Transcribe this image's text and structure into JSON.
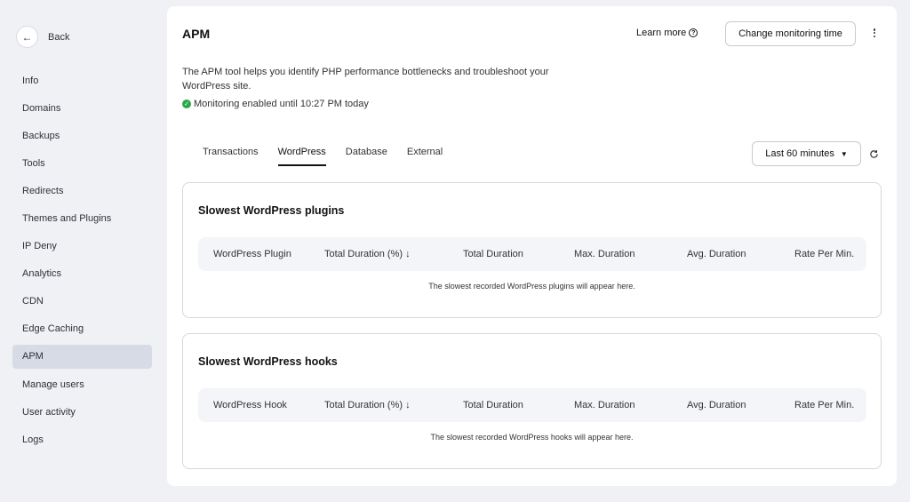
{
  "sidebar": {
    "back_label": "Back",
    "items": [
      {
        "label": "Info"
      },
      {
        "label": "Domains"
      },
      {
        "label": "Backups"
      },
      {
        "label": "Tools"
      },
      {
        "label": "Redirects"
      },
      {
        "label": "Themes and Plugins"
      },
      {
        "label": "IP Deny"
      },
      {
        "label": "Analytics"
      },
      {
        "label": "CDN"
      },
      {
        "label": "Edge Caching"
      },
      {
        "label": "APM",
        "active": true
      },
      {
        "label": "Manage users"
      },
      {
        "label": "User activity"
      },
      {
        "label": "Logs"
      }
    ]
  },
  "header": {
    "title": "APM",
    "learn_more": "Learn more",
    "change_monitoring": "Change monitoring time",
    "description": "The APM tool helps you identify PHP performance bottlenecks and troubleshoot your WordPress site.",
    "status": "Monitoring enabled until 10:27 PM today",
    "status_color": "#2aa84a"
  },
  "tabs": [
    {
      "label": "Transactions"
    },
    {
      "label": "WordPress",
      "active": true
    },
    {
      "label": "Database"
    },
    {
      "label": "External"
    }
  ],
  "time_range": {
    "selected": "Last 60 minutes"
  },
  "sections": [
    {
      "title": "Slowest WordPress plugins",
      "columns": [
        "WordPress Plugin",
        "Total Duration (%) ↓",
        "Total Duration",
        "Max. Duration",
        "Avg. Duration",
        "Rate Per Min."
      ],
      "empty": "The slowest recorded WordPress plugins will appear here."
    },
    {
      "title": "Slowest WordPress hooks",
      "columns": [
        "WordPress Hook",
        "Total Duration (%) ↓",
        "Total Duration",
        "Max. Duration",
        "Avg. Duration",
        "Rate Per Min."
      ],
      "empty": "The slowest recorded WordPress hooks will appear here."
    }
  ]
}
